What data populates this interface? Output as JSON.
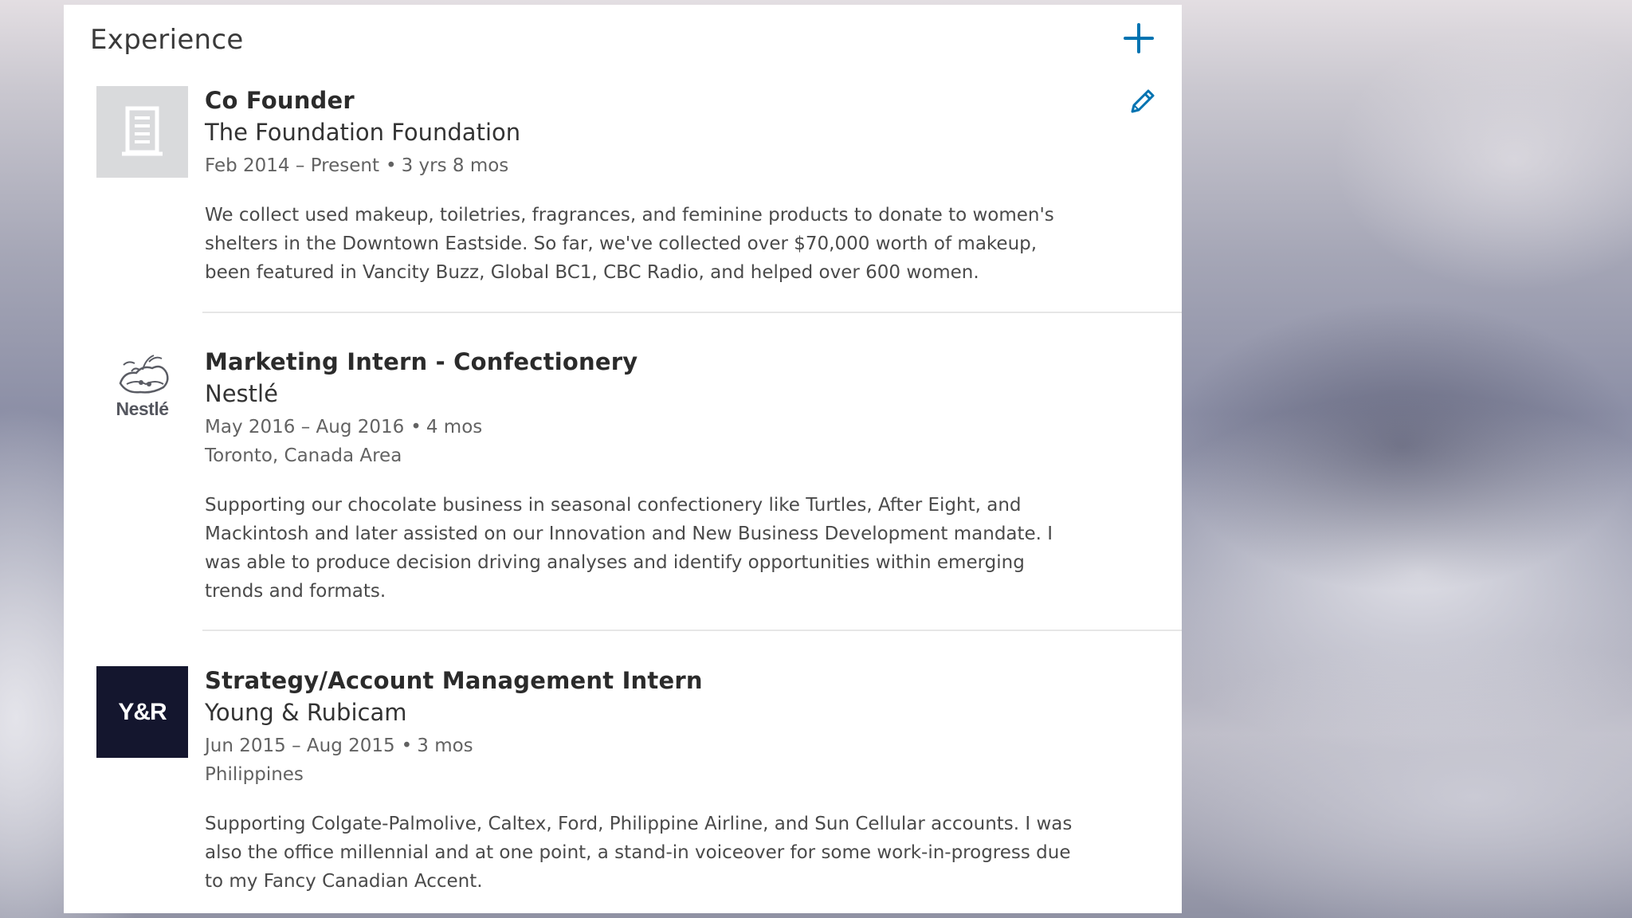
{
  "section": {
    "title": "Experience",
    "add_icon": "plus-icon",
    "edit_icon": "pencil-icon"
  },
  "colors": {
    "accent": "#0073b1",
    "card_background": "#ffffff",
    "placeholder_logo": "#d9dadc",
    "yr_logo_background": "#14162e"
  },
  "experiences": [
    {
      "title": "Co Founder",
      "company": "The Foundation Foundation",
      "dates": "Feb 2014 – Present",
      "duration": "3 yrs 8 mos",
      "location": "",
      "description": "We collect used makeup, toiletries, fragrances, and feminine products to donate to women's shelters in the Downtown Eastside. So far, we've collected over $70,000 worth of makeup, been featured in Vancity Buzz, Global BC1, CBC Radio, and helped over 600 women.",
      "logo": {
        "type": "building-icon",
        "text": ""
      }
    },
    {
      "title": "Marketing Intern - Confectionery",
      "company": "Nestlé",
      "dates": "May 2016 – Aug 2016",
      "duration": "4 mos",
      "location": "Toronto, Canada Area",
      "description": "Supporting our chocolate business in seasonal confectionery like Turtles, After Eight, and Mackintosh and later assisted on our Innovation and New Business Development mandate. I was able to produce decision driving analyses and identify opportunities within emerging trends and formats.",
      "logo": {
        "type": "nestle-logo",
        "text": "Nestlé"
      }
    },
    {
      "title": "Strategy/Account Management Intern",
      "company": "Young & Rubicam",
      "dates": "Jun 2015 – Aug 2015",
      "duration": "3 mos",
      "location": "Philippines",
      "description": "Supporting Colgate-Palmolive, Caltex, Ford, Philippine Airline, and Sun Cellular accounts. I was also the office millennial and at one point, a stand-in voiceover for some work-in-progress due to my Fancy Canadian Accent.",
      "logo": {
        "type": "yr-logo",
        "text": "Y&R"
      }
    }
  ]
}
